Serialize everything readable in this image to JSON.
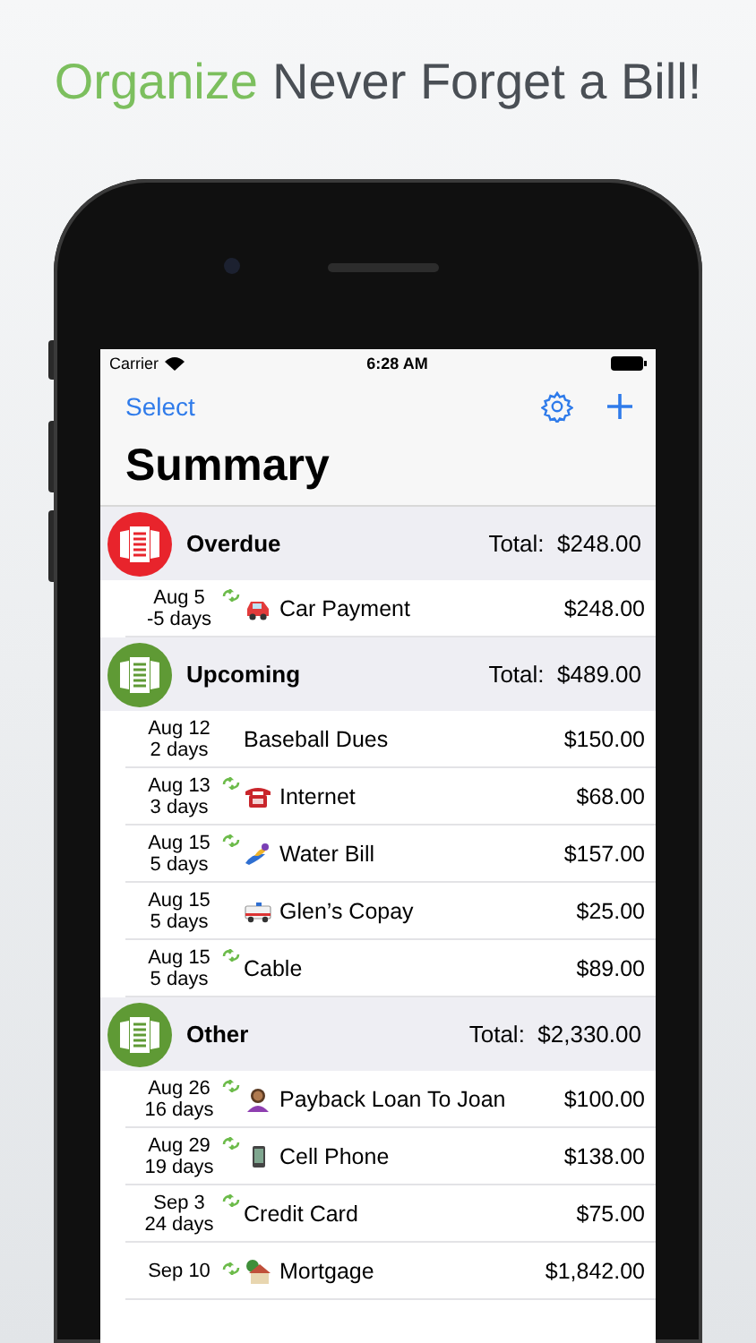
{
  "headline": {
    "highlight": "Organize",
    "text": "Never Forget a Bill!"
  },
  "status_bar": {
    "carrier": "Carrier",
    "time": "6:28 AM"
  },
  "nav": {
    "left_button": "Select",
    "title": "Summary"
  },
  "sections": [
    {
      "title": "Overdue",
      "total": "Total:  $248.00",
      "color": "#e8242c",
      "bills": [
        {
          "date": "Aug 5",
          "due": "-5 days",
          "recurring": true,
          "kind": "car",
          "name": "Car Payment",
          "amount": "$248.00"
        }
      ]
    },
    {
      "title": "Upcoming",
      "total": "Total:  $489.00",
      "color": "#5f9a35",
      "bills": [
        {
          "date": "Aug 12",
          "due": "2 days",
          "recurring": false,
          "kind": "plain",
          "name": "Baseball Dues",
          "amount": "$150.00"
        },
        {
          "date": "Aug 13",
          "due": "3 days",
          "recurring": true,
          "kind": "telephone",
          "name": "Internet",
          "amount": "$68.00"
        },
        {
          "date": "Aug 15",
          "due": "5 days",
          "recurring": true,
          "kind": "swimmer",
          "name": "Water Bill",
          "amount": "$157.00"
        },
        {
          "date": "Aug 15",
          "due": "5 days",
          "recurring": false,
          "kind": "ambulance",
          "name": "Glen’s Copay",
          "amount": "$25.00"
        },
        {
          "date": "Aug 15",
          "due": "5 days",
          "recurring": true,
          "kind": "plain",
          "name": "Cable",
          "amount": "$89.00"
        }
      ]
    },
    {
      "title": "Other",
      "total": "Total:  $2,330.00",
      "color": "#5f9a35",
      "bills": [
        {
          "date": "Aug 26",
          "due": "16 days",
          "recurring": true,
          "kind": "person",
          "name": "Payback Loan To Joan",
          "amount": "$100.00"
        },
        {
          "date": "Aug 29",
          "due": "19 days",
          "recurring": true,
          "kind": "cellphone",
          "name": "Cell Phone",
          "amount": "$138.00"
        },
        {
          "date": "Sep 3",
          "due": "24 days",
          "recurring": true,
          "kind": "plain",
          "name": "Credit Card",
          "amount": "$75.00"
        },
        {
          "date": "Sep 10",
          "recurring": true,
          "kind": "house",
          "name": "Mortgage",
          "amount": "$1,842.00"
        }
      ]
    }
  ]
}
